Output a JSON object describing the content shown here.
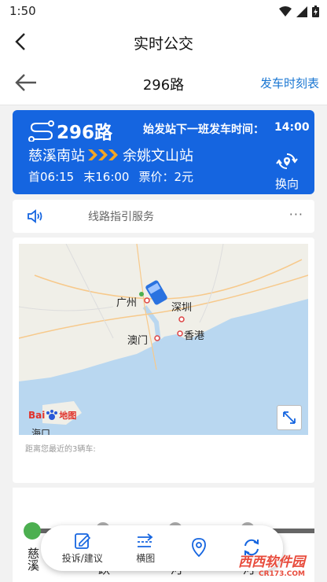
{
  "status": {
    "time": "1:50"
  },
  "header": {
    "title": "实时公交"
  },
  "subheader": {
    "route": "296路",
    "timetable_label": "发车时刻表"
  },
  "route_card": {
    "number": "296路",
    "next_departure_label": "始发站下一班发车时间：",
    "next_departure_time": "14:00",
    "from_stop": "慈溪南站",
    "to_stop": "余姚文山站",
    "first_bus": "首06:15",
    "last_bus": "末16:00",
    "fare": "票价：2元",
    "reverse_label": "换向",
    "colors": {
      "card": "#1565e0",
      "arrow": "#f5a623"
    }
  },
  "guide": {
    "label": "线路指引服务",
    "more": "···"
  },
  "map": {
    "cities": [
      "广州",
      "深圳",
      "澳门",
      "香港",
      "海口"
    ],
    "logo_text": "Bai",
    "logo_text2": "地图",
    "nearby_text": "距离您最近的3辆车:"
  },
  "stops": [
    "慈溪",
    "跃",
    "河",
    "河"
  ],
  "toolbar": {
    "items": [
      {
        "label": "投诉/建议",
        "icon": "edit-icon"
      },
      {
        "label": "横图",
        "icon": "horizontal-arrows-icon"
      },
      {
        "label": "",
        "icon": "location-pin-icon"
      },
      {
        "label": "",
        "icon": "refresh-icon"
      }
    ]
  },
  "watermark": {
    "text": "西西软件园",
    "sub": "CR173.COM"
  }
}
